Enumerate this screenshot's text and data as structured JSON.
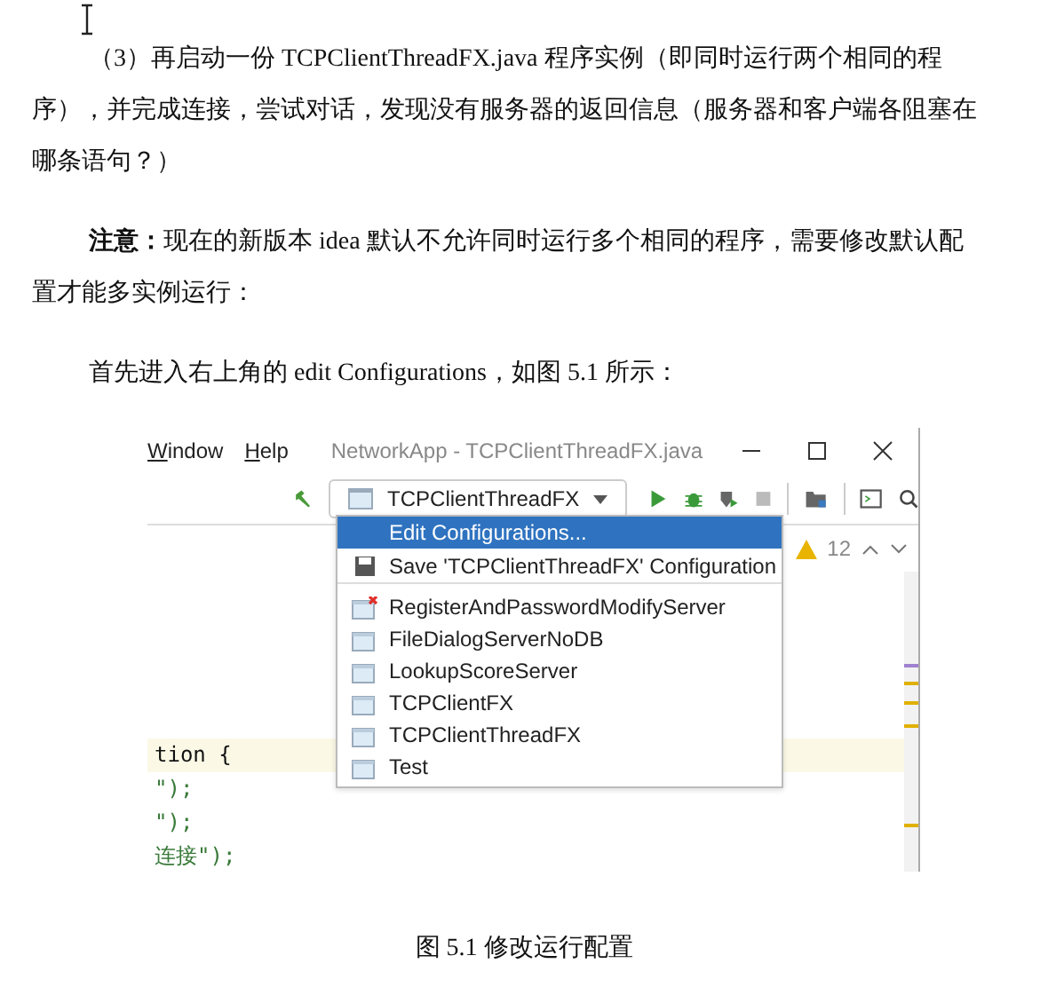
{
  "paragraphs": [
    {
      "kind": "body",
      "text": "（3）再启动一份 TCPClientThreadFX.java 程序实例（即同时运行两个相同的程序），并完成连接，尝试对话，发现没有服务器的返回信息（服务器和客户端各阻塞在哪条语句？）"
    },
    {
      "kind": "body",
      "text": "**注意：**现在的新版本 idea 默认不允许同时运行多个相同的程序，需要修改默认配置才能多实例运行："
    },
    {
      "kind": "body",
      "text": "首先进入右上角的 edit Configurations，如图 5.1 所示："
    }
  ],
  "figure": {
    "menu": [
      "Window",
      "Help"
    ],
    "title": "NetworkApp - TCPClientThreadFX.java",
    "run_config": "TCPClientThreadFX",
    "dropdown": [
      {
        "kind": "action",
        "label": "Edit Configurations...",
        "selected": true
      },
      {
        "kind": "save",
        "label": "Save 'TCPClientThreadFX' Configuration",
        "selected": false
      },
      {
        "kind": "config",
        "label": "RegisterAndPasswordModifyServer",
        "selected": false,
        "error": true
      },
      {
        "kind": "config",
        "label": "FileDialogServerNoDB",
        "selected": false,
        "error": false
      },
      {
        "kind": "config",
        "label": "LookupScoreServer",
        "selected": false,
        "error": false
      },
      {
        "kind": "config",
        "label": "TCPClientFX",
        "selected": false,
        "error": false
      },
      {
        "kind": "config",
        "label": "TCPClientThreadFX",
        "selected": false,
        "error": false
      },
      {
        "kind": "config",
        "label": "Test",
        "selected": false,
        "error": false
      }
    ],
    "warnings": "12",
    "code_lines": [
      {
        "text": "tion {",
        "highlighted": true
      },
      {
        "text": "\");",
        "highlighted": false
      },
      {
        "text": "\");",
        "highlighted": false
      },
      {
        "text": "连接\");",
        "highlighted": false
      }
    ]
  },
  "caption": "图 5.1  修改运行配置"
}
